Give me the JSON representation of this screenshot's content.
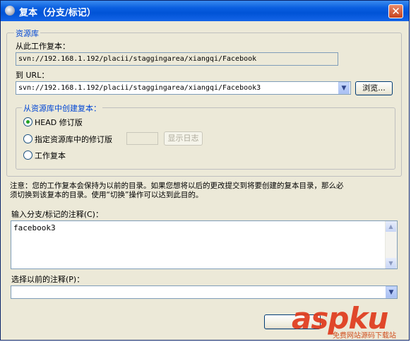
{
  "window": {
    "title": "复本（分支/标记）",
    "close_glyph": "✕"
  },
  "repo_group": {
    "label": "资源库",
    "from_wc_label": "从此工作复本：",
    "from_wc_value": "svn://192.168.1.192/placii/staggingarea/xiangqi/Facebook",
    "to_url_label": "到 URL：",
    "to_url_value": "svn://192.168.1.192/placii/staggingarea/xiangqi/Facebook3",
    "browse_label": "浏览..."
  },
  "create_group": {
    "label": "从资源库中创建复本：",
    "options": [
      {
        "label": "HEAD 修订版",
        "selected": true
      },
      {
        "label": "指定资源库中的修订版",
        "selected": false
      },
      {
        "label": "工作复本",
        "selected": false
      }
    ],
    "revision_value": "",
    "show_log_label": "显示日志"
  },
  "note": {
    "line1": "注意：您的工作复本会保持为以前的目录。如果您想将以后的更改提交到将要创建的复本目录，那么必",
    "line2": "须切换到该复本的目录。使用“切换”操作可以达到此目的。"
  },
  "comment": {
    "label": "输入分支/标记的注释(C)：",
    "value": "facebook3"
  },
  "previous": {
    "label": "选择以前的注释(P)：",
    "value": ""
  },
  "watermark": {
    "text": "aspku",
    "sub": "免费网站源码下载站"
  },
  "colors": {
    "titlebar": "#0053d6",
    "group_label": "#0046d5",
    "watermark": "#e03a1c"
  }
}
